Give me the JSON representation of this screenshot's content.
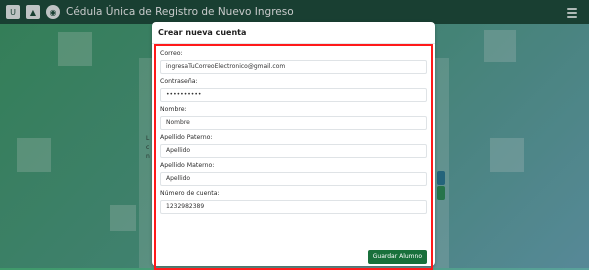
{
  "header": {
    "title": "Cédula Única de Registro de Nuevo Ingreso",
    "icons": [
      "unam-logo-icon",
      "institution-logo-icon",
      "seal-logo-icon",
      "hamburger-menu-icon"
    ]
  },
  "background_page": {
    "lines": [
      "L",
      "c",
      "n"
    ]
  },
  "modal": {
    "title": "Crear nueva cuenta",
    "fields": [
      {
        "label": "Correo:",
        "value": "ingresaTuCorreoElectronico@gmail.com"
      },
      {
        "label": "Contraseña:",
        "value": "••••••••••"
      },
      {
        "label": "Nombre:",
        "value": "Nombre"
      },
      {
        "label": "Apellido Paterno:",
        "value": "Apellido"
      },
      {
        "label": "Apellido Materno:",
        "value": "Apellido"
      },
      {
        "label": "Número de cuenta:",
        "value": "1232982389"
      }
    ],
    "save_label": "Guardar Alumno"
  },
  "colors": {
    "header_bg": "#1f4e3d",
    "highlight_border": "#ff1a1a",
    "save_button": "#19703b"
  }
}
